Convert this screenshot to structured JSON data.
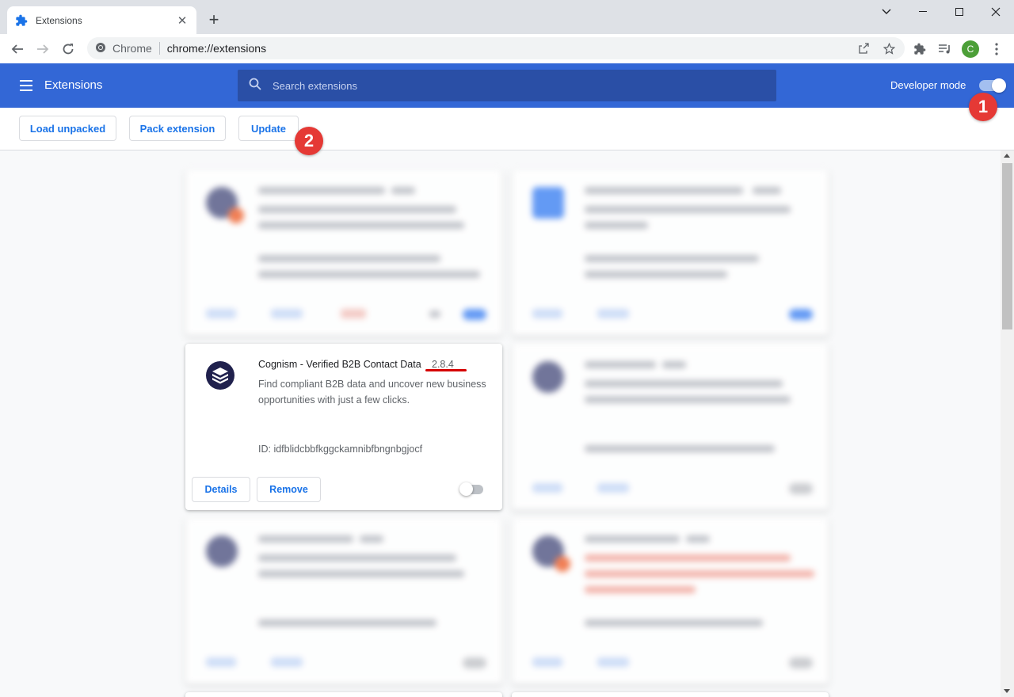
{
  "browser": {
    "tab_title": "Extensions",
    "omnibox_site": "Chrome",
    "omnibox_url": "chrome://extensions",
    "avatar_letter": "C"
  },
  "header": {
    "title": "Extensions",
    "search_placeholder": "Search extensions",
    "developer_mode_label": "Developer mode",
    "developer_mode_on": true
  },
  "dev_toolbar": {
    "load_unpacked": "Load unpacked",
    "pack_extension": "Pack extension",
    "update": "Update"
  },
  "annotations": {
    "step1": "1",
    "step2": "2"
  },
  "extension_card": {
    "name": "Cognism - Verified B2B Contact Data",
    "version": "2.8.4",
    "description": "Find compliant B2B data and uncover new business opportunities with just a few clicks.",
    "id_text": "ID: idfblidcbbfkggckamnibfbngnbgjocf",
    "details_label": "Details",
    "remove_label": "Remove",
    "enabled": false
  },
  "colors": {
    "header_blue": "#3367d6",
    "link_blue": "#1a73e8",
    "annotation_red": "#e53935"
  }
}
